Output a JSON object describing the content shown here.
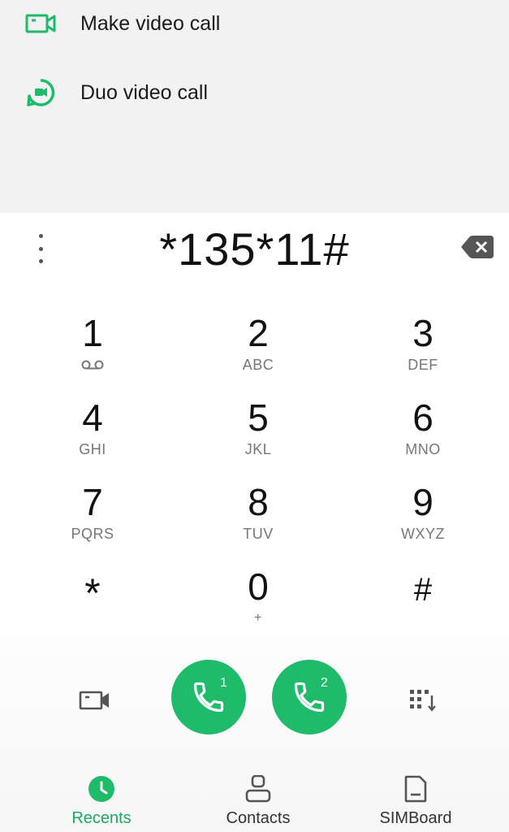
{
  "actions": [
    {
      "label": "Make video call",
      "icon": "video-camera-icon"
    },
    {
      "label": "Duo video call",
      "icon": "duo-icon"
    }
  ],
  "dialer": {
    "number": "*135*11#"
  },
  "keypad": [
    {
      "digit": "1",
      "letters": "",
      "sub_icon": "voicemail-icon"
    },
    {
      "digit": "2",
      "letters": "ABC"
    },
    {
      "digit": "3",
      "letters": "DEF"
    },
    {
      "digit": "4",
      "letters": "GHI"
    },
    {
      "digit": "5",
      "letters": "JKL"
    },
    {
      "digit": "6",
      "letters": "MNO"
    },
    {
      "digit": "7",
      "letters": "PQRS"
    },
    {
      "digit": "8",
      "letters": "TUV"
    },
    {
      "digit": "9",
      "letters": "WXYZ"
    },
    {
      "digit": "*",
      "letters": ""
    },
    {
      "digit": "0",
      "letters": "+"
    },
    {
      "digit": "#",
      "letters": ""
    }
  ],
  "call_buttons": [
    {
      "sim": "1"
    },
    {
      "sim": "2"
    }
  ],
  "colors": {
    "accent": "#1dbb6a",
    "accent_text": "#1aa95e"
  },
  "nav": [
    {
      "label": "Recents",
      "icon": "clock-icon",
      "active": true
    },
    {
      "label": "Contacts",
      "icon": "person-icon",
      "active": false
    },
    {
      "label": "SIMBoard",
      "icon": "sim-card-icon",
      "active": false
    }
  ]
}
